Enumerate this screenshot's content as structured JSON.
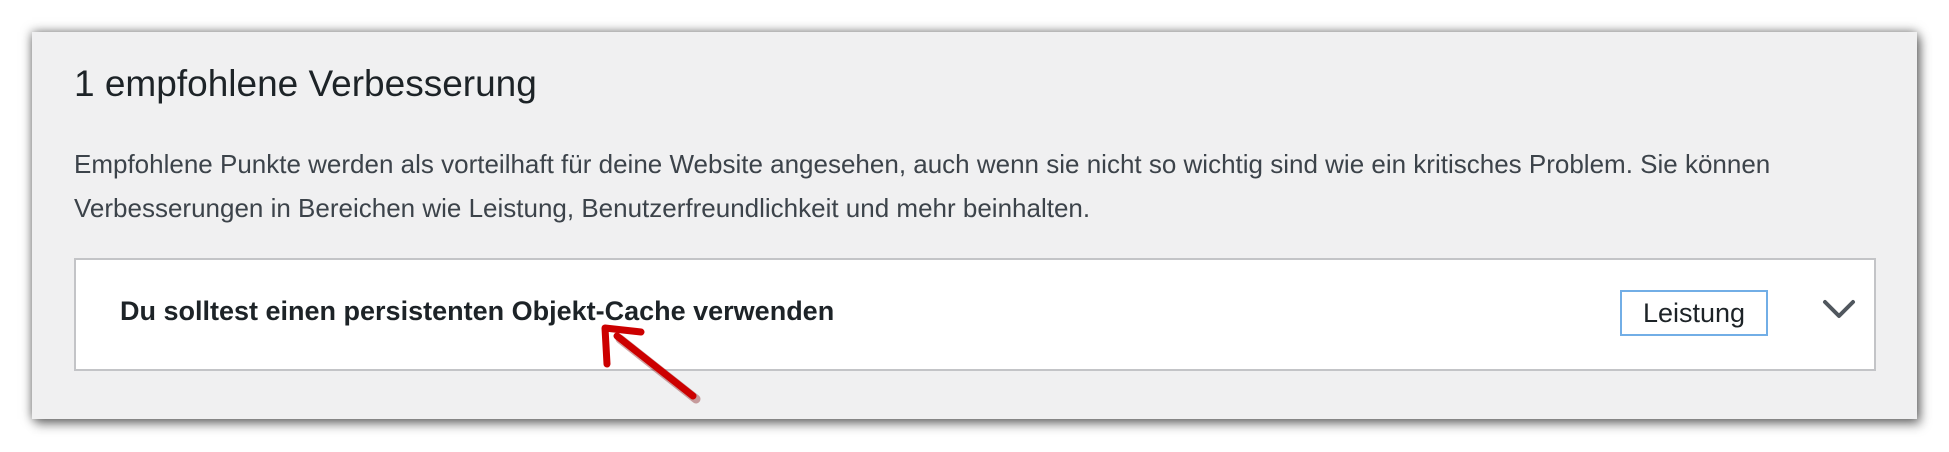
{
  "section": {
    "title": "1 empfohlene Verbesserung",
    "description": "Empfohlene Punkte werden als vorteilhaft für deine Website angesehen, auch wenn sie nicht so wichtig sind wie ein kritisches Problem. Sie können Verbesserungen in Bereichen wie Leistung, Benutzerfreundlichkeit und mehr beinhalten."
  },
  "items": [
    {
      "title": "Du solltest einen persistenten Objekt-Cache verwenden",
      "badge": "Leistung",
      "expanded": false,
      "toggle_icon": "chevron-down-icon"
    }
  ],
  "annotation": {
    "icon": "red-pointer-arrow-icon",
    "color": "#cc0000"
  },
  "colors": {
    "panel_background": "#f0f0f1",
    "item_border": "#c3c4c7",
    "badge_border": "#72aee6",
    "text": "#1d2327"
  }
}
